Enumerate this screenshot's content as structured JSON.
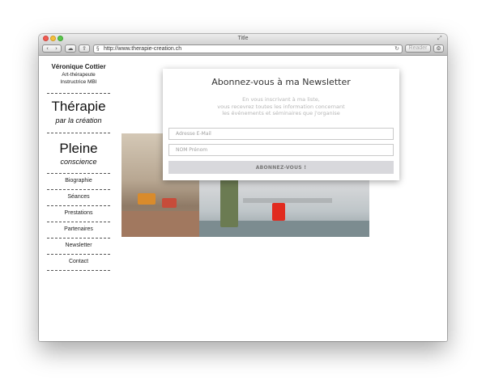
{
  "window": {
    "title": "Title",
    "url": "http://www.therapie-creation.ch",
    "reader_label": "Reader"
  },
  "icons": {
    "back": "‹",
    "forward": "›",
    "icloud": "☁",
    "share": "⇪",
    "reload": "↻",
    "secure": "§",
    "settings": "⚙",
    "fullscreen": "⤢"
  },
  "sidebar": {
    "owner_name": "Véronique Cottier",
    "role_1": "Art-thérapeute",
    "role_2": "Instructrice MBI",
    "brand_1_title": "Thérapie",
    "brand_1_sub": "par la création",
    "brand_2_title": "Pleine",
    "brand_2_sub": "conscience",
    "menu": [
      {
        "label": "Biographie"
      },
      {
        "label": "Séances"
      },
      {
        "label": "Prestations"
      },
      {
        "label": "Partenaires"
      },
      {
        "label": "Newsletter"
      },
      {
        "label": "Contact"
      }
    ]
  },
  "newsletter": {
    "title": "Abonnez-vous à ma Newsletter",
    "desc_1": "En vous inscrivant à ma liste,",
    "desc_2": "vous recevrez toutes les information concernant",
    "desc_3": "les événements et séminaires que j'organise",
    "email_placeholder": "Adresse E-Mail",
    "name_placeholder": "NOM Prénom",
    "submit_label": "ABONNEZ-VOUS !"
  },
  "colors": {
    "stool_red": "#e12b1f",
    "button_bg": "#d8d8dc"
  }
}
